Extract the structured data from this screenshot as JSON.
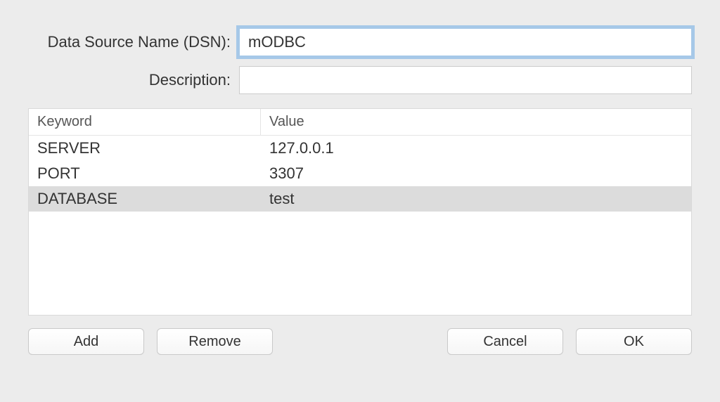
{
  "form": {
    "dsn_label": "Data Source Name (DSN):",
    "dsn_value": "mODBC",
    "description_label": "Description:",
    "description_value": ""
  },
  "table": {
    "headers": {
      "keyword": "Keyword",
      "value": "Value"
    },
    "rows": [
      {
        "keyword": "SERVER",
        "value": "127.0.0.1",
        "selected": false
      },
      {
        "keyword": "PORT",
        "value": "3307",
        "selected": false
      },
      {
        "keyword": "DATABASE",
        "value": "test",
        "selected": true
      }
    ]
  },
  "buttons": {
    "add": "Add",
    "remove": "Remove",
    "cancel": "Cancel",
    "ok": "OK"
  }
}
